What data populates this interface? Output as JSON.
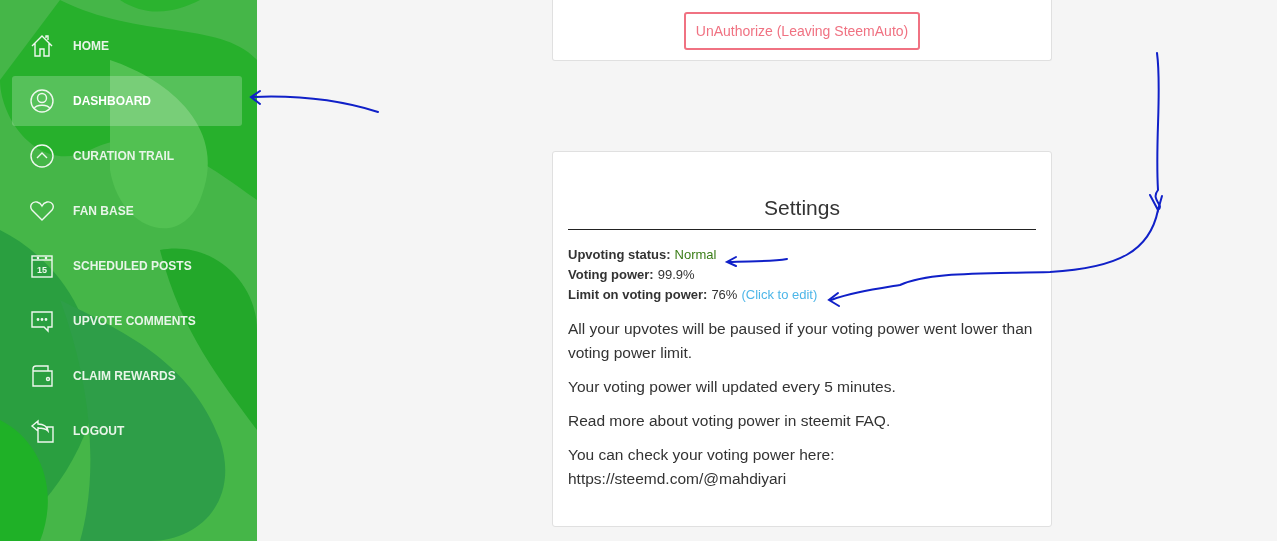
{
  "sidebar": {
    "items": [
      {
        "label": "HOME",
        "selected": false
      },
      {
        "label": "DASHBOARD",
        "selected": true
      },
      {
        "label": "CURATION TRAIL",
        "selected": false
      },
      {
        "label": "FAN BASE",
        "selected": false
      },
      {
        "label": "SCHEDULED POSTS",
        "icon_text": "15",
        "selected": false
      },
      {
        "label": "UPVOTE COMMENTS",
        "selected": false
      },
      {
        "label": "CLAIM REWARDS",
        "selected": false
      },
      {
        "label": "LOGOUT",
        "selected": false
      }
    ]
  },
  "auth_card": {
    "button": "UnAuthorize (Leaving SteemAuto)"
  },
  "settings": {
    "title": "Settings",
    "status_lines": [
      {
        "label": "Upvoting status:",
        "value": "Normal",
        "kind": "status"
      },
      {
        "label": "Voting power:",
        "value": "99.9%",
        "kind": "plain"
      },
      {
        "label": "Limit on voting power:",
        "value": "76%",
        "link": "(Click to edit)",
        "kind": "plain"
      }
    ],
    "paragraphs": [
      "All your upvotes will be paused if your voting power went lower than voting power limit.",
      "Your voting power will updated every 5 minutes.",
      "Read more about voting power in steemit FAQ.",
      "You can check your voting power here: https://steemd.com/@mahdiyari"
    ]
  }
}
